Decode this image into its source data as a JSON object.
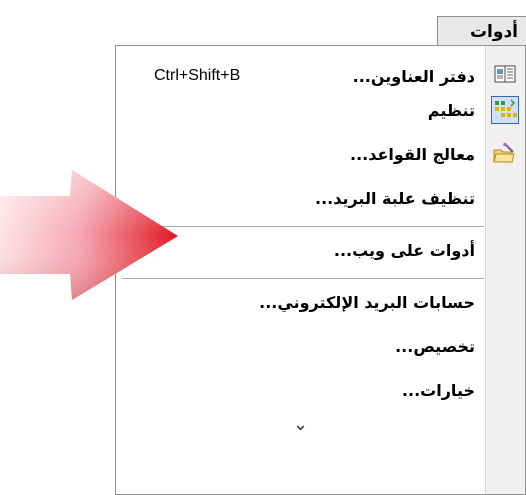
{
  "menu": {
    "title": "أدوات",
    "items": [
      {
        "label": "دفتر العناوين...",
        "shortcut": "Ctrl+Shift+B",
        "icon": "address-book-icon"
      },
      {
        "label": "تنظيم",
        "icon": "organize-icon"
      },
      {
        "label": "معالج القواعد...",
        "icon": "rules-wizard-icon"
      },
      {
        "label": "تنظيف علبة البريد..."
      },
      {
        "label": "أدوات على ويب..."
      },
      {
        "label": "حسابات البريد الإلكتروني..."
      },
      {
        "label": "تخصيص..."
      },
      {
        "label": "خيارات..."
      }
    ],
    "expand_symbol": "⌄"
  },
  "colors": {
    "menu_bg": "#ffffff",
    "icon_column": "#f1f0ee",
    "header_bg": "#e9e8e6",
    "arrow_red": "#e0141e",
    "arrow_pink": "#f9cfd6"
  }
}
